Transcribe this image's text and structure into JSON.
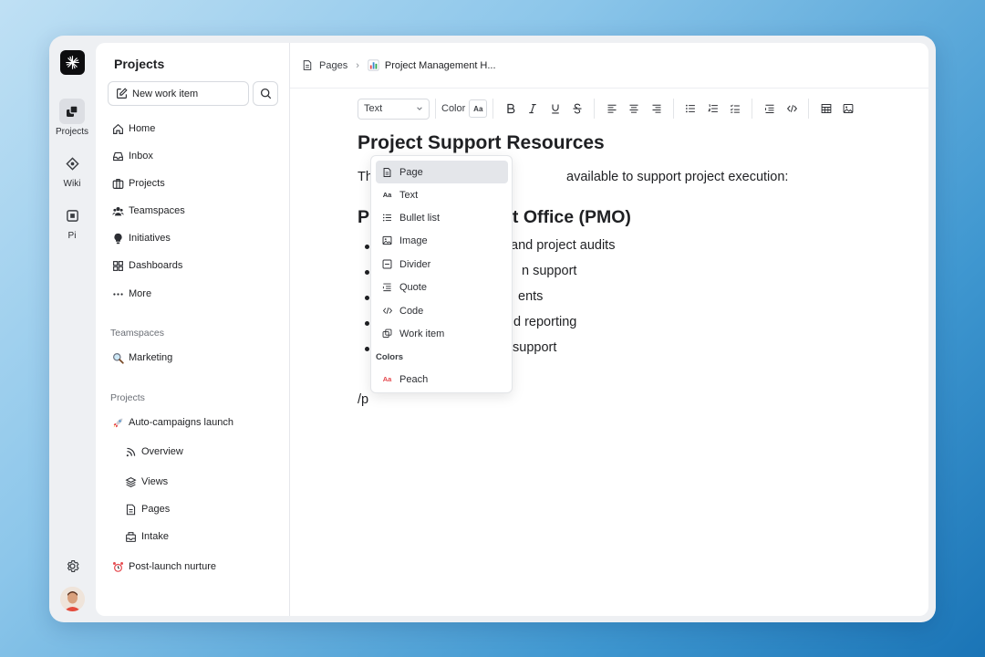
{
  "rail": {
    "items": [
      {
        "label": "Projects",
        "icon": "projects-icon",
        "active": true
      },
      {
        "label": "Wiki",
        "icon": "wiki-icon"
      },
      {
        "label": "Pi",
        "icon": "pi-icon"
      }
    ]
  },
  "sidebar": {
    "title": "Projects",
    "new_item_label": "New work item",
    "nav": [
      {
        "label": "Home",
        "icon": "home-icon"
      },
      {
        "label": "Inbox",
        "icon": "inbox-icon"
      },
      {
        "label": "Projects",
        "icon": "briefcase-icon"
      },
      {
        "label": "Teamspaces",
        "icon": "people-icon"
      },
      {
        "label": "Initiatives",
        "icon": "lightbulb-icon"
      },
      {
        "label": "Dashboards",
        "icon": "grid-icon"
      },
      {
        "label": "More",
        "icon": "ellipsis-icon"
      }
    ],
    "teamspaces_label": "Teamspaces",
    "teamspaces": [
      {
        "label": "Marketing",
        "icon": "magnifier-emoji-icon"
      }
    ],
    "projects_label": "Projects",
    "projects": [
      {
        "label": "Auto-campaigns launch",
        "icon": "rocket-emoji-icon"
      },
      {
        "label": "Overview",
        "icon": "rss-icon"
      },
      {
        "label": "Views",
        "icon": "layers-icon"
      },
      {
        "label": "Pages",
        "icon": "page-icon"
      },
      {
        "label": "Intake",
        "icon": "intake-icon"
      },
      {
        "label": "Post-launch nurture",
        "icon": "alarm-clock-emoji-icon"
      }
    ]
  },
  "breadcrumb": {
    "pages": "Pages",
    "current": "Project Management H..."
  },
  "toolbar": {
    "text_style": "Text",
    "color_label": "Color",
    "color_glyph": "Aa"
  },
  "doc": {
    "title": "Project Support Resources",
    "intro_start": "Th",
    "intro_end": "available to support project execution:",
    "heading_start": "P",
    "heading_end": "nt Office (PMO)",
    "bullets": [
      "and project audits",
      "n support",
      "ents",
      "d reporting",
      "support"
    ],
    "typed": "/p"
  },
  "menu": {
    "items": [
      {
        "label": "Page",
        "icon": "page-icon"
      },
      {
        "label": "Text",
        "icon": "text-icon"
      },
      {
        "label": "Bullet list",
        "icon": "bullet-list-icon"
      },
      {
        "label": "Image",
        "icon": "image-icon"
      },
      {
        "label": "Divider",
        "icon": "divider-icon"
      },
      {
        "label": "Quote",
        "icon": "quote-icon"
      },
      {
        "label": "Code",
        "icon": "code-icon"
      },
      {
        "label": "Work item",
        "icon": "work-item-icon"
      }
    ],
    "colors_label": "Colors",
    "colors": [
      {
        "label": "Peach",
        "icon": "text-color-icon",
        "color": "#e5484d"
      }
    ]
  }
}
